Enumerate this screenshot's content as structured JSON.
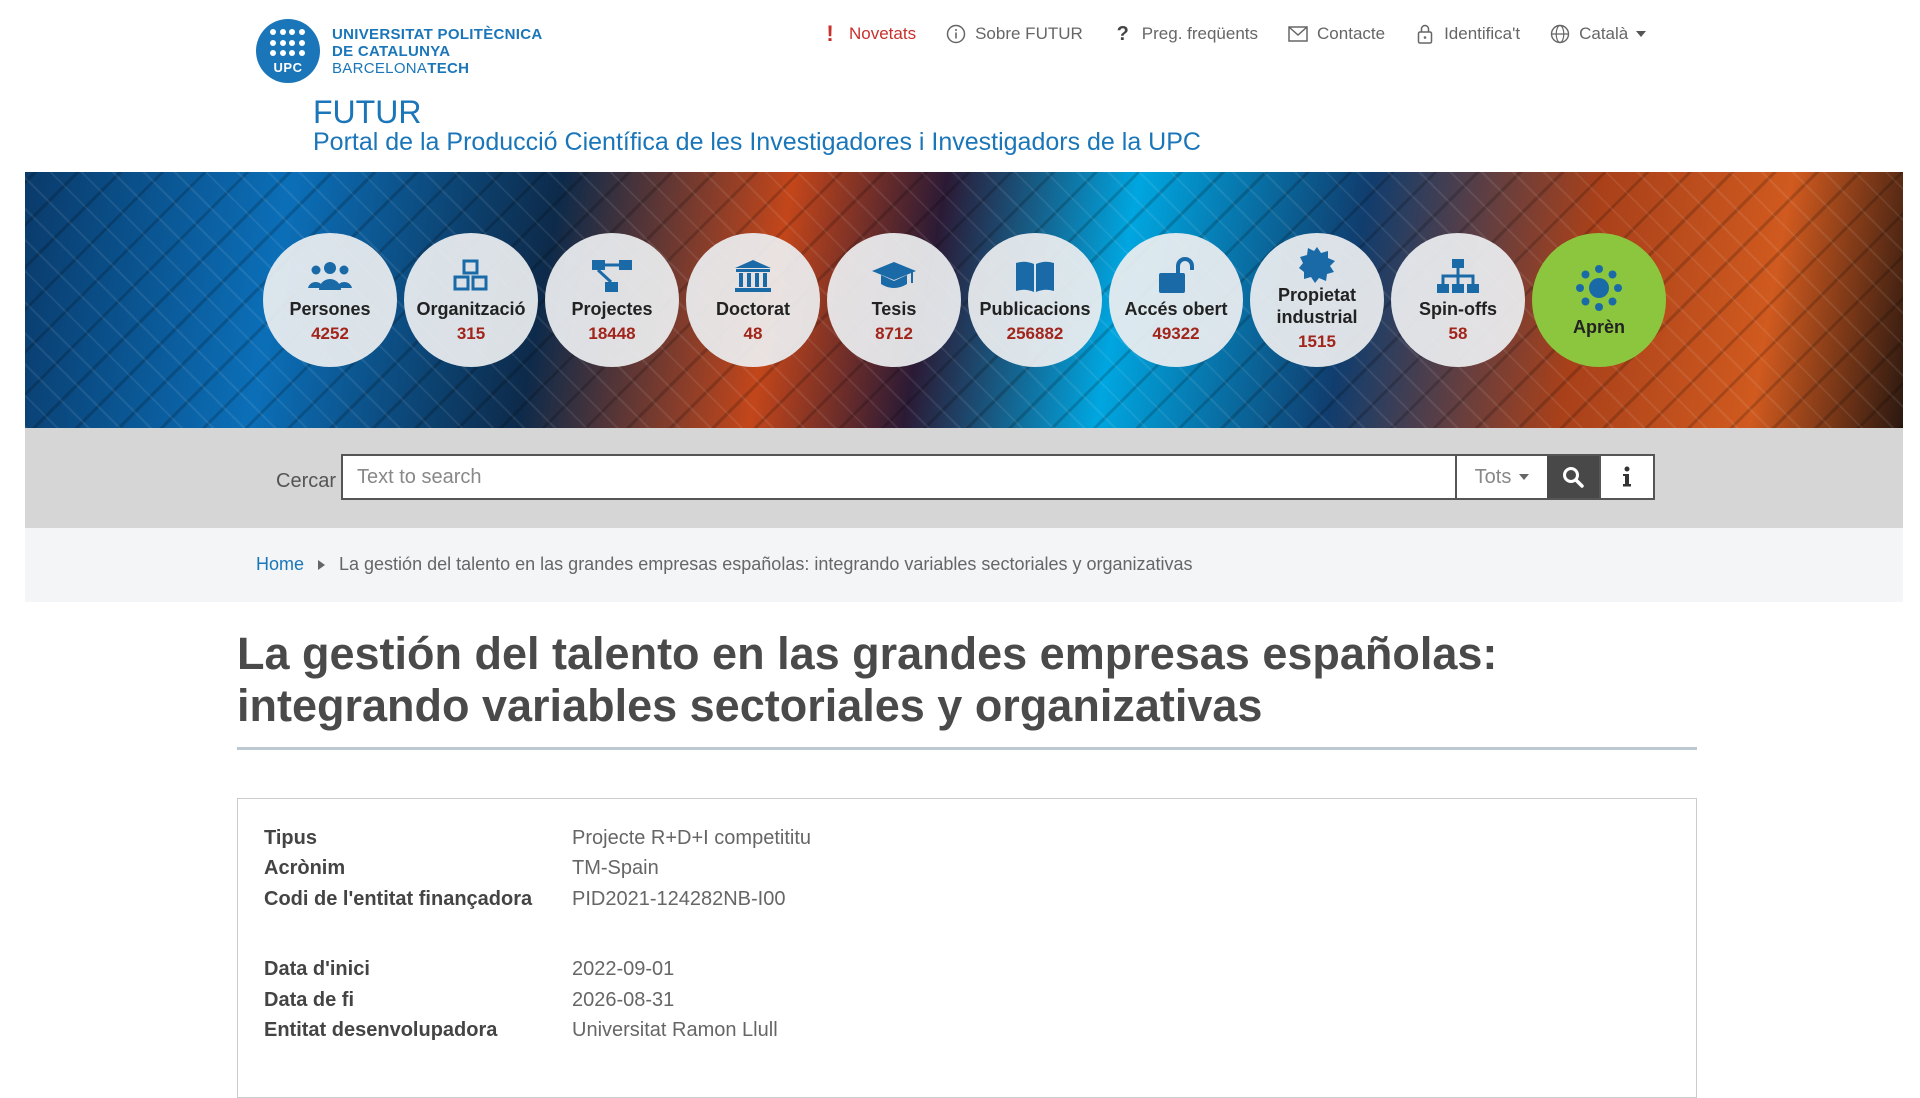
{
  "logo": {
    "abbr": "UPC",
    "line1": "UNIVERSITAT POLITÈCNICA",
    "line2": "DE CATALUNYA",
    "line3_a": "BARCELONA",
    "line3_b": "TECH"
  },
  "topnav": {
    "novetats": "Novetats",
    "sobre": "Sobre FUTUR",
    "preg": "Preg. freqüents",
    "contacte": "Contacte",
    "identifica": "Identifica't",
    "idioma": "Català"
  },
  "header": {
    "title": "FUTUR",
    "subtitle": "Portal de la Producció Científica de les Investigadores i Investigadors de la UPC"
  },
  "categories": [
    {
      "label": "Persones",
      "count": "4252",
      "icon": "people-icon"
    },
    {
      "label": "Organització",
      "count": "315",
      "icon": "cubes-icon"
    },
    {
      "label": "Projectes",
      "count": "18448",
      "icon": "project-diagram-icon"
    },
    {
      "label": "Doctorat",
      "count": "48",
      "icon": "institution-icon"
    },
    {
      "label": "Tesis",
      "count": "8712",
      "icon": "graduation-cap-icon"
    },
    {
      "label": "Publicacions",
      "count": "256882",
      "icon": "book-icon"
    },
    {
      "label": "Accés obert",
      "count": "49322",
      "icon": "unlock-icon"
    },
    {
      "label_line1": "Propietat",
      "label_line2": "industrial",
      "count": "1515",
      "icon": "badge-icon"
    },
    {
      "label": "Spin-offs",
      "count": "58",
      "icon": "sitemap-icon"
    },
    {
      "label": "Aprèn",
      "icon": "flower-icon"
    }
  ],
  "search": {
    "label": "Cercar",
    "placeholder": "Text to search",
    "scope": "Tots"
  },
  "breadcrumb": {
    "home": "Home",
    "current": "La gestión del talento en las grandes empresas españolas: integrando variables sectoriales y organizativas"
  },
  "page_title": "La gestión del talento en las grandes empresas españolas: integrando variables sectoriales y organizativas",
  "details": [
    {
      "key": "Tipus",
      "value": "Projecte R+D+I competititu"
    },
    {
      "key": "Acrònim",
      "value": "TM-Spain"
    },
    {
      "key": "Codi de l'entitat finançadora",
      "value": "PID2021-124282NB-I00"
    },
    {
      "key": "Data d'inici",
      "value": "2022-09-01"
    },
    {
      "key": "Data de fi",
      "value": "2026-08-31"
    },
    {
      "key": "Entitat desenvolupadora",
      "value": "Universitat Ramon Llull"
    }
  ],
  "colors": {
    "brand_blue": "#1a76b8",
    "count_red": "#a1251b",
    "learn_green": "#8cc63e",
    "news_red": "#c9302c"
  }
}
